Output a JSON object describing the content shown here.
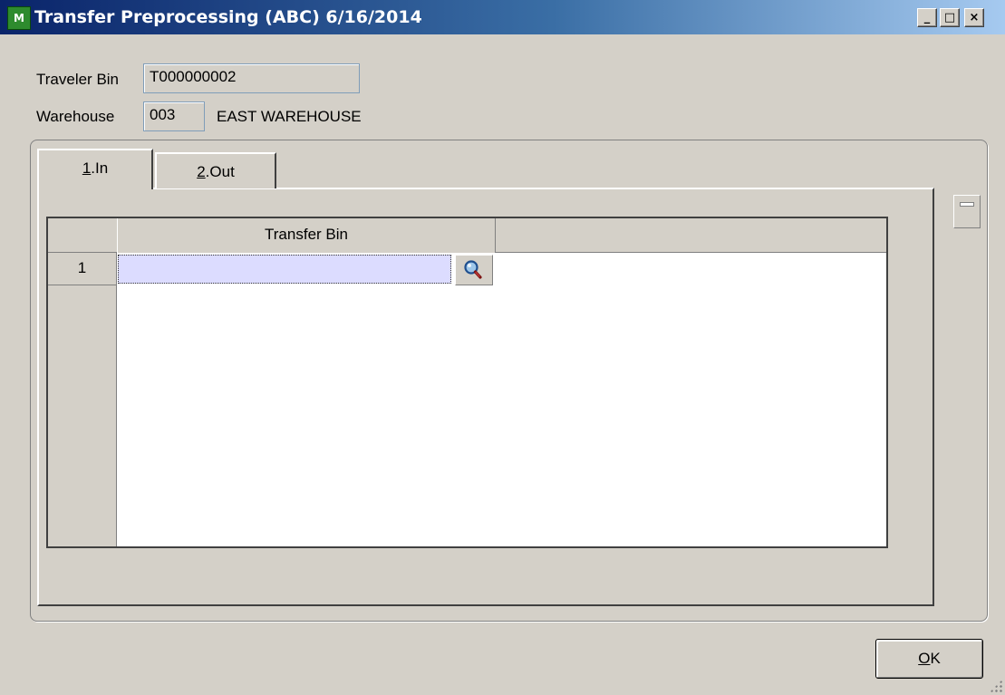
{
  "window": {
    "title": "Transfer Preprocessing (ABC) 6/16/2014",
    "app_icon": "MAS 90 app icon",
    "caption_buttons": {
      "minimize": "_",
      "maximize": "□",
      "close": "×"
    }
  },
  "header": {
    "traveler_bin_label": "Traveler Bin",
    "traveler_bin_value": "T000000002",
    "warehouse_label": "Warehouse",
    "warehouse_code": "003",
    "warehouse_name": "EAST WAREHOUSE"
  },
  "tabs": [
    {
      "hotkey": "1",
      "rest": ".In",
      "selected": true
    },
    {
      "hotkey": "2",
      "rest": ".Out",
      "selected": false
    }
  ],
  "grid": {
    "columns": [
      "Transfer Bin"
    ],
    "rows": [
      {
        "number": "1",
        "transfer_bin": ""
      }
    ],
    "lookup_icon": "magnifier-lookup-icon"
  },
  "footer": {
    "ok_hotkey": "O",
    "ok_rest": "K"
  }
}
